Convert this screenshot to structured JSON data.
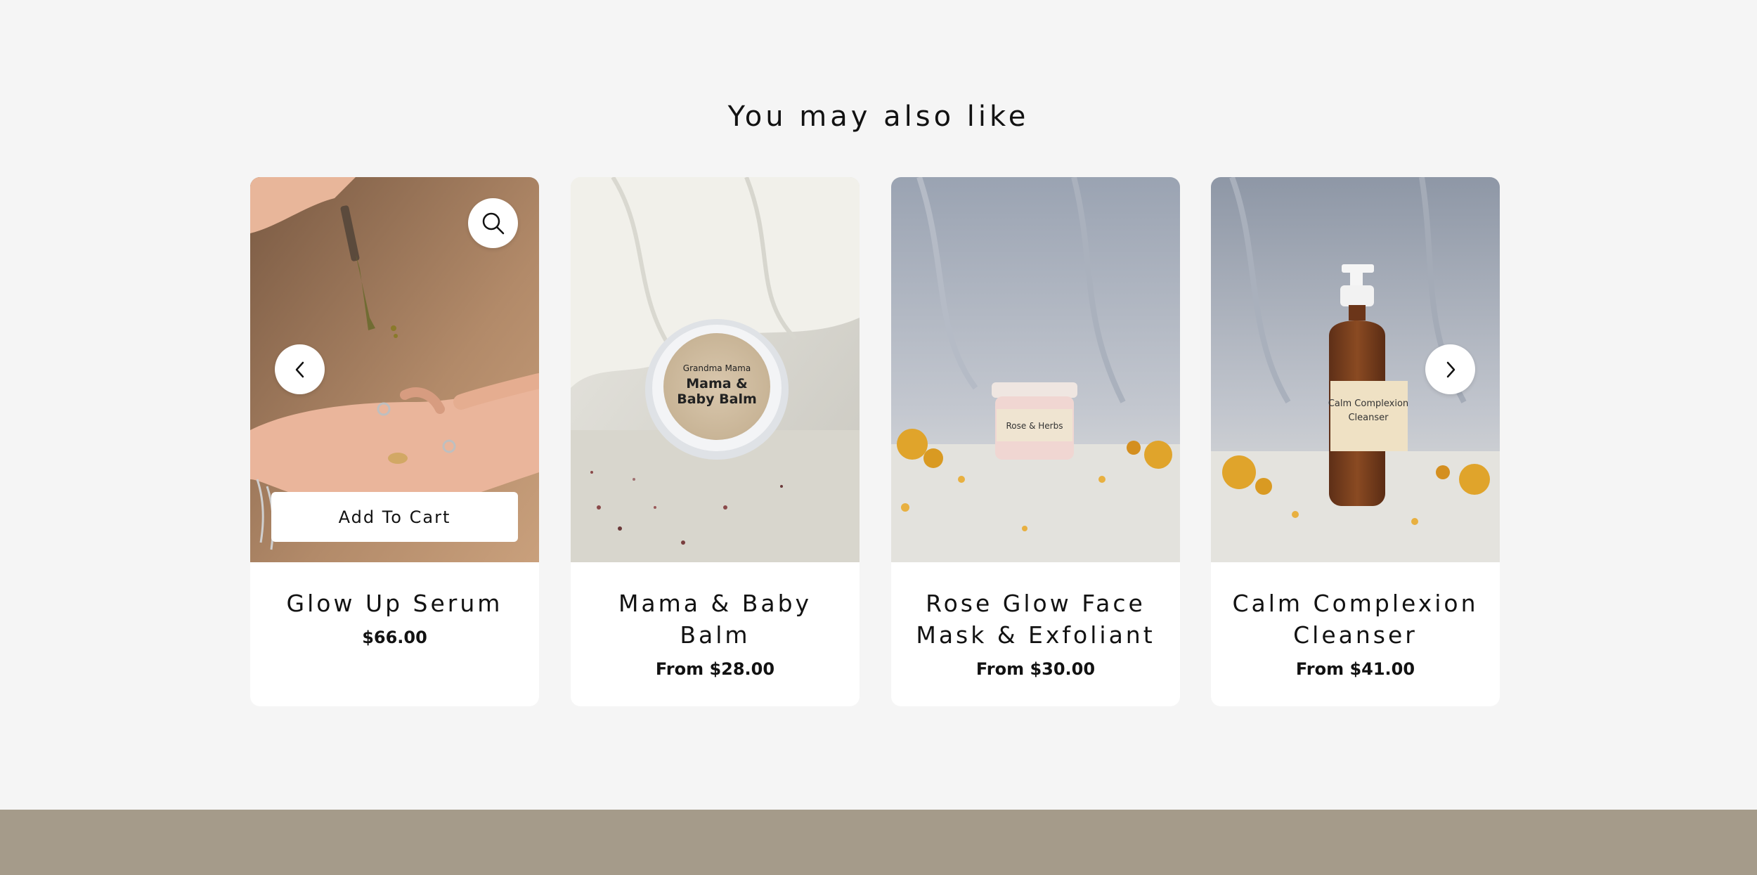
{
  "section": {
    "title": "You may also like"
  },
  "products": [
    {
      "title": "Glow Up Serum",
      "price": "$66.00",
      "image": "hand-with-dropper-photo"
    },
    {
      "title": "Mama & Baby Balm",
      "price": "From $28.00",
      "image": "balm-tin-on-linen-photo"
    },
    {
      "title": "Rose Glow Face Mask & Exfoliant",
      "price": "From $30.00",
      "image": "jar-with-marigolds-photo"
    },
    {
      "title": "Calm Complexion Cleanser",
      "price": "From $41.00",
      "image": "pump-bottle-photo"
    }
  ],
  "quick_add": {
    "label": "Add To Cart"
  },
  "icons": {
    "zoom": "magnifier-icon",
    "prev": "chevron-left-icon",
    "next": "chevron-right-icon"
  },
  "colors": {
    "page_bg": "#f5f5f5",
    "card_bg": "#ffffff",
    "footer_band": "#a59b8a",
    "text": "#121212"
  }
}
